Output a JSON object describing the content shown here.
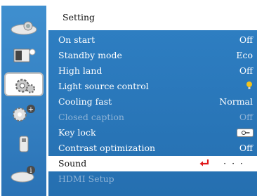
{
  "header": {
    "title": "Setting"
  },
  "sidebar": {
    "tabs": [
      {
        "icon": "projector-icon"
      },
      {
        "icon": "image-adjust-icon"
      },
      {
        "icon": "settings-gears-icon",
        "active": true
      },
      {
        "icon": "advanced-settings-icon"
      },
      {
        "icon": "usb-icon"
      },
      {
        "icon": "info-icon"
      }
    ]
  },
  "menu": {
    "items": [
      {
        "label": "On start",
        "value": "Off"
      },
      {
        "label": "Standby mode",
        "value": "Eco"
      },
      {
        "label": "High land",
        "value": "Off"
      },
      {
        "label": "Light source control",
        "value_icon": "bulb-icon"
      },
      {
        "label": "Cooling fast",
        "value": "Normal"
      },
      {
        "label": "Closed caption",
        "value": "Off",
        "disabled": true
      },
      {
        "label": "Key lock",
        "value_icon": "key-lock-icon"
      },
      {
        "label": "Contrast optimization",
        "value": "Off"
      },
      {
        "label": "Sound",
        "value": "· · ·",
        "selected": true
      },
      {
        "label": "HDMI Setup",
        "value": "",
        "disabled": true
      }
    ]
  },
  "colors": {
    "accent": "#2f80c4",
    "enter_icon": "#e0191b",
    "bulb": "#f2c21b"
  }
}
